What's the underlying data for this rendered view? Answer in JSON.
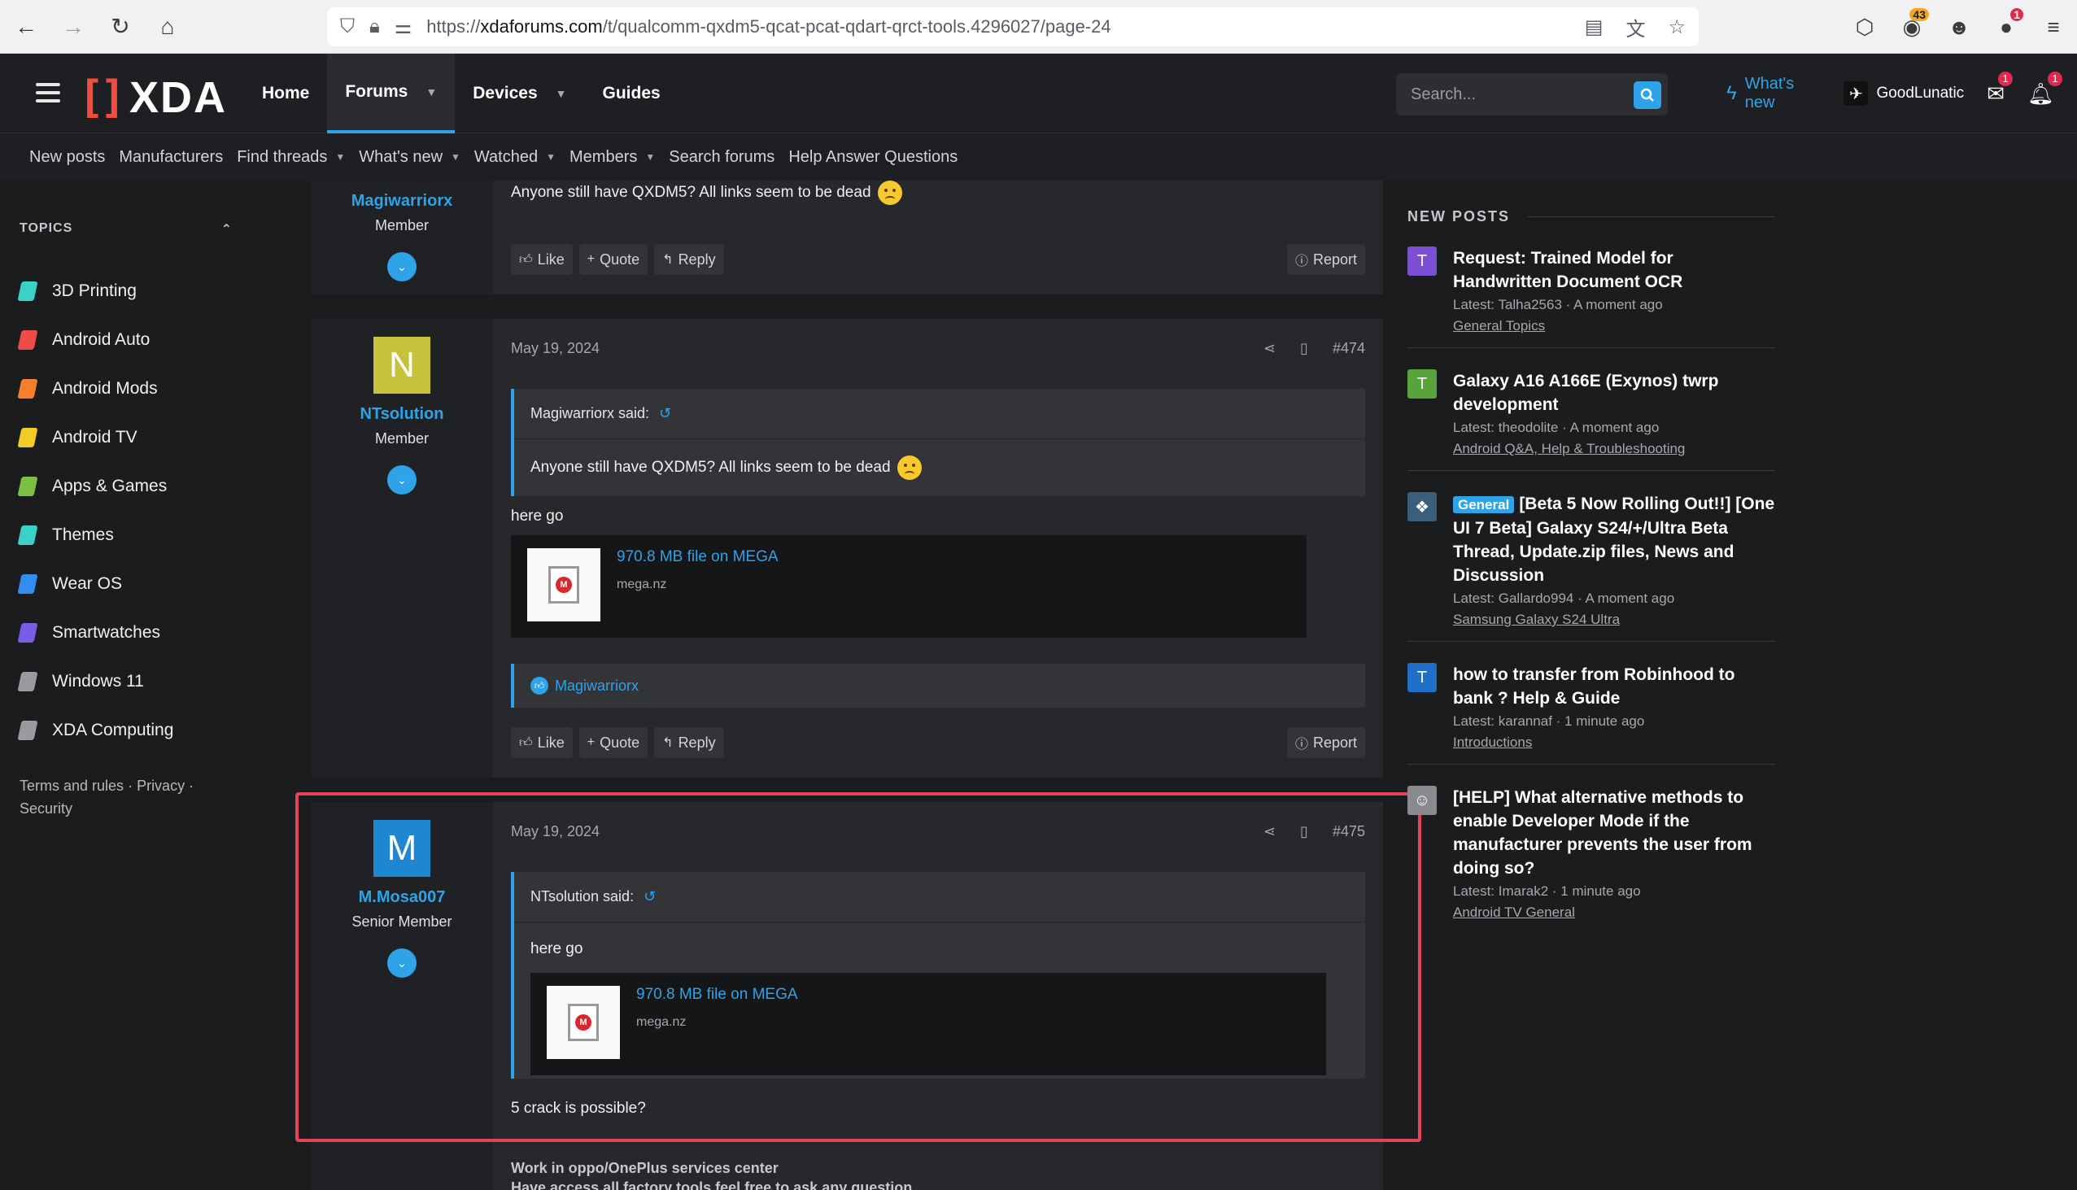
{
  "browser": {
    "url_prefix": "https://",
    "url_host": "xdaforums.com",
    "url_path": "/t/qualcomm-qxdm5-qcat-pcat-qdart-qrct-tools.4296027/page-24",
    "badges": {
      "extension": "43",
      "profile": "1"
    }
  },
  "header": {
    "logo": "XDA",
    "nav": {
      "home": "Home",
      "forums": "Forums",
      "devices": "Devices",
      "guides": "Guides"
    },
    "search_placeholder": "Search...",
    "whats_new": "What's new",
    "username": "GoodLunatic",
    "inbox_count": "1",
    "alerts_count": "1"
  },
  "subnav": [
    "New posts",
    "Manufacturers",
    "Find threads",
    "What's new",
    "Watched",
    "Members",
    "Search forums",
    "Help Answer Questions"
  ],
  "sidebar": {
    "heading": "TOPICS",
    "topics": [
      {
        "label": "3D Printing",
        "color": "#3ad1c6"
      },
      {
        "label": "Android Auto",
        "color": "#ef4b4b"
      },
      {
        "label": "Android Mods",
        "color": "#f57f2a"
      },
      {
        "label": "Android TV",
        "color": "#f2cb24"
      },
      {
        "label": "Apps & Games",
        "color": "#7bc043"
      },
      {
        "label": "Themes",
        "color": "#3ad1c6"
      },
      {
        "label": "Wear OS",
        "color": "#2f8ef0"
      },
      {
        "label": "Smartwatches",
        "color": "#7b5ce5"
      },
      {
        "label": "Windows 11",
        "color": "#9a9a9e"
      },
      {
        "label": "XDA Computing",
        "color": "#9a9a9e"
      }
    ],
    "footer_terms": "Terms and rules",
    "footer_privacy": "Privacy",
    "footer_security": "Security"
  },
  "posts": [
    {
      "user": "Magiwarriorx",
      "role": "Member",
      "text": "Anyone still have QXDM5? All links seem to be dead",
      "actions": {
        "like": "Like",
        "quote": "Quote",
        "reply": "Reply",
        "report": "Report"
      }
    },
    {
      "user": "NTsolution",
      "initial": "N",
      "avatar_color": "#c7c23a",
      "role": "Member",
      "date": "May 19, 2024",
      "number": "#474",
      "quote_author": "Magiwarriorx said:",
      "quote_text": "Anyone still have QXDM5? All links seem to be dead",
      "text": "here go",
      "embed_title": "970.8 MB file on MEGA",
      "embed_domain": "mega.nz",
      "reaction_user": "Magiwarriorx",
      "actions": {
        "like": "Like",
        "quote": "Quote",
        "reply": "Reply",
        "report": "Report"
      }
    },
    {
      "user": "M.Mosa007",
      "initial": "M",
      "avatar_color": "#1f86d1",
      "role": "Senior Member",
      "date": "May 19, 2024",
      "number": "#475",
      "quote_author": "NTsolution said:",
      "quote_text": "here go",
      "embed_title": "970.8 MB file on MEGA",
      "embed_domain": "mega.nz",
      "text": "5 crack is possible?",
      "signature_1": "Work in oppo/OnePlus services center",
      "signature_2": "Have access all factory tools feel free to ask any question"
    }
  ],
  "new_posts": {
    "heading": "NEW POSTS",
    "items": [
      {
        "initial": "T",
        "color": "#7b4fd1",
        "tag": "",
        "title": "Request: Trained Model for Handwritten Document OCR",
        "latest": "Latest: Talha2563 · A moment ago",
        "forum": "General Topics"
      },
      {
        "initial": "T",
        "color": "#58a33a",
        "tag": "",
        "title": "Galaxy A16 A166E (Exynos) twrp development",
        "latest": "Latest: theodolite · A moment ago",
        "forum": "Android Q&A, Help & Troubleshooting"
      },
      {
        "initial": "",
        "color": "#3b5f7a",
        "tag": "General",
        "title": "[Beta 5 Now Rolling Out!!] [One UI 7 Beta] Galaxy S24/+/Ultra Beta Thread, Update.zip files, News and Discussion",
        "latest": "Latest: Gallardo994 · A moment ago",
        "forum": "Samsung Galaxy S24 Ultra"
      },
      {
        "initial": "T",
        "color": "#1f6fc7",
        "tag": "",
        "title": "how to transfer from Robinhood to bank ? Help & Guide",
        "latest": "Latest: karannaf · 1 minute ago",
        "forum": "Introductions"
      },
      {
        "initial": "",
        "color": "#8a8a8e",
        "tag": "",
        "title": "[HELP] What alternative methods to enable Developer Mode if the manufacturer prevents the user from doing so?",
        "latest": "Latest: Imarak2 · 1 minute ago",
        "forum": "Android TV General"
      }
    ]
  }
}
